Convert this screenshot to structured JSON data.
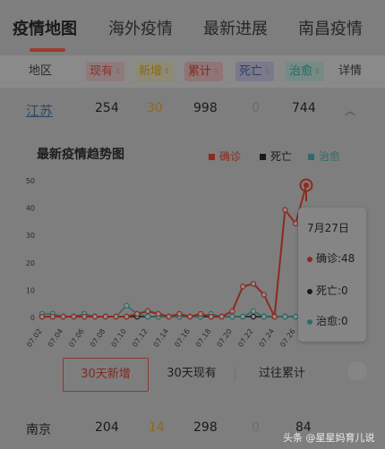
{
  "tabs": [
    "疫情地图",
    "海外疫情",
    "最新进展",
    "南昌疫情"
  ],
  "table_header": {
    "area": "地区",
    "current": "现有",
    "new": "新增",
    "total": "累计",
    "dead": "死亡",
    "cured": "治愈",
    "details": "详情"
  },
  "rows": [
    {
      "name": "江苏",
      "current": "254",
      "new": "30",
      "total": "998",
      "dead": "0",
      "cured": "744"
    },
    {
      "name": "南京",
      "current": "204",
      "new": "14",
      "total": "298",
      "dead": "0",
      "cured": "84"
    }
  ],
  "chart_data": {
    "type": "line",
    "title": "最新疫情趋势图",
    "x": [
      "07.02",
      "07.03",
      "07.04",
      "07.05",
      "07.06",
      "07.07",
      "07.08",
      "07.09",
      "07.10",
      "07.11",
      "07.12",
      "07.13",
      "07.14",
      "07.15",
      "07.16",
      "07.17",
      "07.18",
      "07.19",
      "07.20",
      "07.21",
      "07.22",
      "07.23",
      "07.24",
      "07.25",
      "07.26",
      "07.27"
    ],
    "x_tick_labels": [
      "07.02",
      "07.04",
      "07.06",
      "07.08",
      "07.10",
      "07.12",
      "07.14",
      "07.16",
      "07.18",
      "07.20",
      "07.22",
      "07.24",
      "07.26"
    ],
    "ylim": [
      0,
      50
    ],
    "y_ticks": [
      0,
      10,
      20,
      30,
      40,
      50
    ],
    "series": [
      {
        "name": "确诊",
        "color": "#8c2b20",
        "values": [
          0,
          0,
          0,
          0,
          0,
          0,
          0,
          0,
          0,
          1,
          2,
          1,
          0,
          1,
          0,
          1,
          0,
          0,
          2,
          11,
          12,
          8,
          0,
          39,
          34,
          48
        ]
      },
      {
        "name": "死亡",
        "color": "#1a1a1a",
        "values": [
          0,
          0,
          0,
          0,
          0,
          0,
          0,
          0,
          0,
          0,
          0,
          0,
          0,
          0,
          0,
          0,
          0,
          0,
          0,
          0,
          0,
          0,
          0,
          0,
          0,
          0
        ]
      },
      {
        "name": "治愈",
        "color": "#2f6b68",
        "values": [
          1,
          1,
          0,
          0,
          1,
          0,
          0,
          0,
          4,
          1,
          0,
          0,
          0,
          0,
          0,
          0,
          1,
          0,
          0,
          0,
          2,
          0,
          0,
          0,
          0,
          0
        ]
      }
    ],
    "grid": false,
    "legend_position": "top-right"
  },
  "tooltip": {
    "date": "7月27日",
    "confirmed": "确诊:48",
    "dead": "死亡:0",
    "cured": "治愈:0"
  },
  "range_buttons": [
    "30天新增",
    "30天现有",
    "过往累计"
  ],
  "watermark": "头条 @星星妈育儿说",
  "colors": {
    "confirmed": "#8c2b20",
    "dead": "#1a1a1a",
    "cured": "#2f6b68",
    "accent": "#a03a2a"
  }
}
